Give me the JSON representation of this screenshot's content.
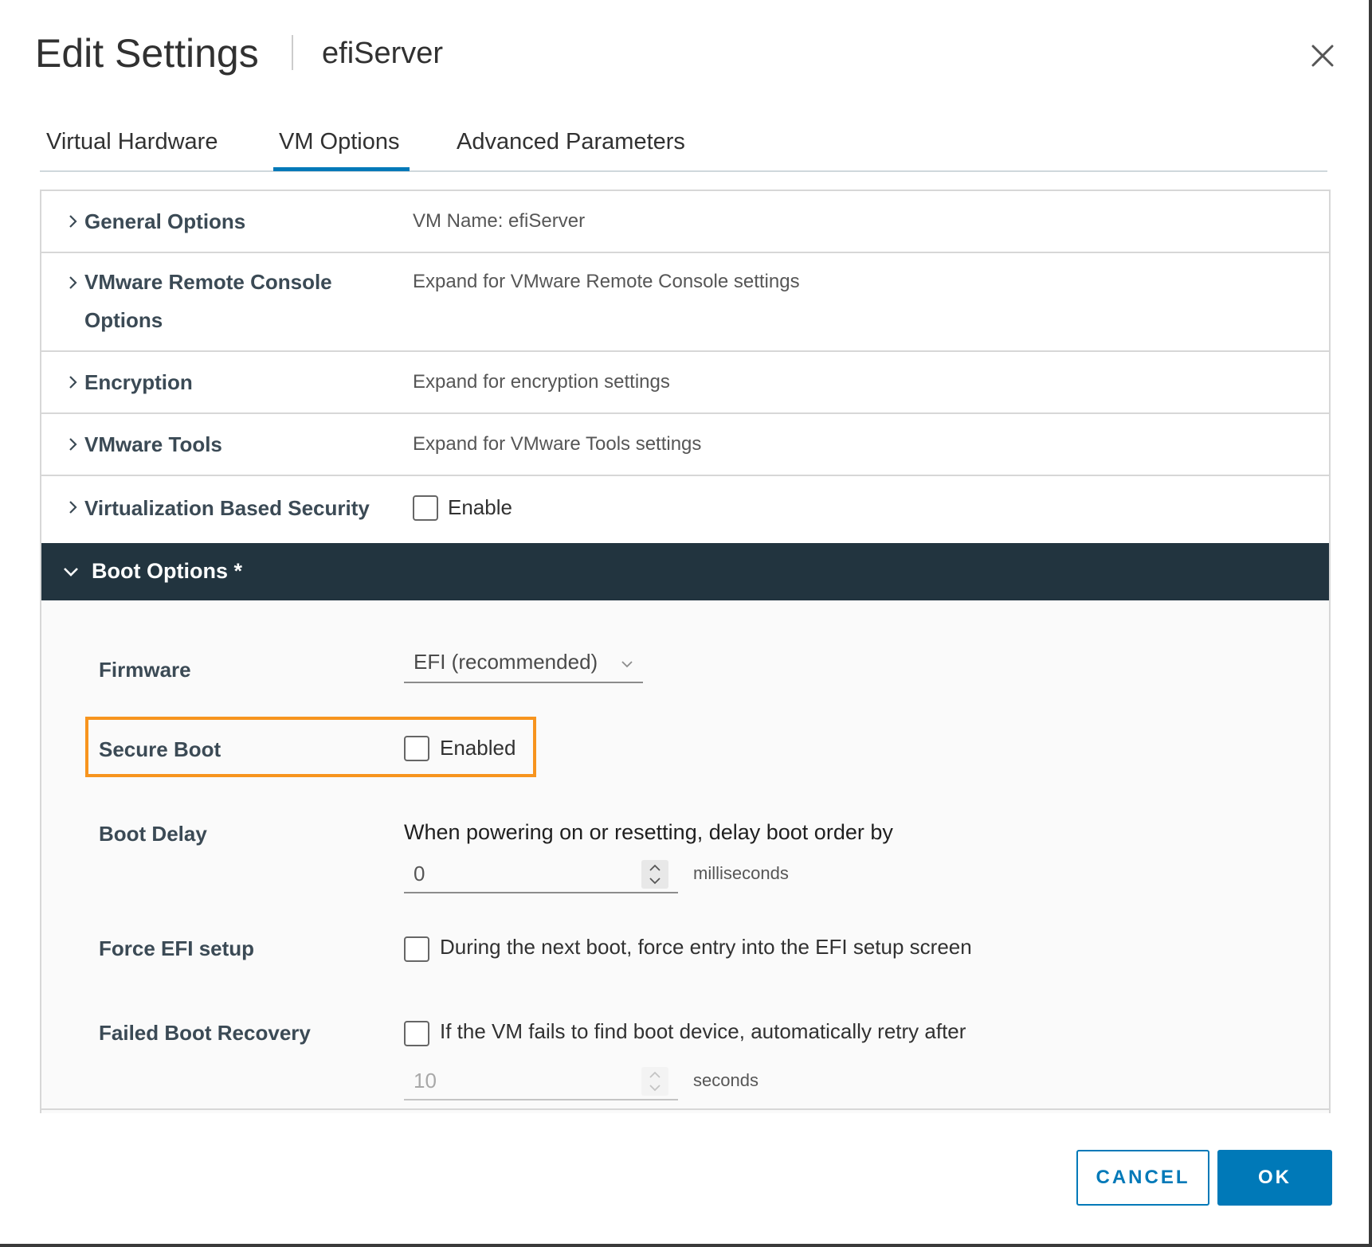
{
  "dialog": {
    "title": "Edit Settings",
    "subtitle": "efiServer",
    "close_icon": "close-icon"
  },
  "tabs": [
    {
      "label": "Virtual Hardware",
      "active": false
    },
    {
      "label": "VM Options",
      "active": true
    },
    {
      "label": "Advanced Parameters",
      "active": false
    }
  ],
  "sections": {
    "general": {
      "label": "General Options",
      "value": "VM Name: efiServer"
    },
    "remote_console": {
      "label_line1": "VMware Remote Console",
      "label_line2": "Options",
      "value": "Expand for VMware Remote Console settings"
    },
    "encryption": {
      "label": "Encryption",
      "value": "Expand for encryption settings"
    },
    "tools": {
      "label": "VMware Tools",
      "value": "Expand for VMware Tools settings"
    },
    "vbs": {
      "label": "Virtualization Based Security",
      "checkbox_label": "Enable",
      "checked": false
    }
  },
  "boot_options": {
    "header": "Boot Options *",
    "firmware": {
      "label": "Firmware",
      "selected": "EFI (recommended)"
    },
    "secure_boot": {
      "label": "Secure Boot",
      "checkbox_label": "Enabled",
      "checked": false
    },
    "boot_delay": {
      "label": "Boot Delay",
      "description": "When powering on or resetting, delay boot order by",
      "value": "0",
      "unit": "milliseconds"
    },
    "force_efi": {
      "label": "Force EFI setup",
      "checkbox_label": "During the next boot, force entry into the EFI setup screen",
      "checked": false
    },
    "failed_boot": {
      "label": "Failed Boot Recovery",
      "checkbox_label": "If the VM fails to find boot device, automatically retry after",
      "checked": false,
      "value": "10",
      "unit": "seconds"
    }
  },
  "footer": {
    "cancel_label": "CANCEL",
    "ok_label": "OK"
  },
  "colors": {
    "accent": "#0079b8",
    "header_dark": "#22343f",
    "highlight": "#f7941e"
  }
}
